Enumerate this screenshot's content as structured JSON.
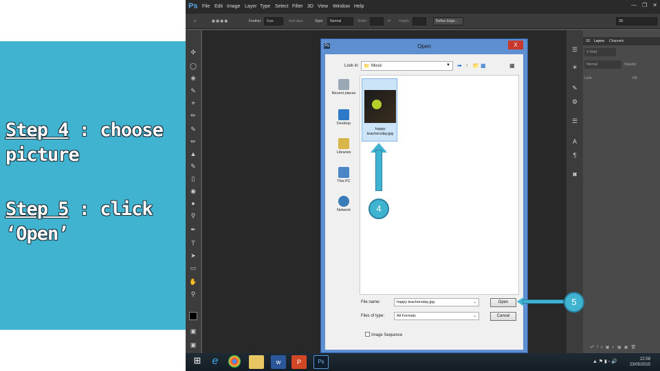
{
  "slide": {
    "step4_prefix": "Step 4",
    "step4_rest": " : choose",
    "step4_line2": "picture",
    "step5_prefix": "Step 5",
    "step5_rest": " : click",
    "step5_line2": "‘Open’"
  },
  "photoshop": {
    "logo": "Ps",
    "menu": [
      "File",
      "Edit",
      "Image",
      "Layer",
      "Type",
      "Select",
      "Filter",
      "3D",
      "View",
      "Window",
      "Help"
    ],
    "options": {
      "feather_label": "Feather:",
      "feather_value": "0 px",
      "antialias_label": "Anti-alias",
      "style_label": "Style:",
      "style_value": "Normal",
      "width_label": "Width:",
      "height_label": "Height:",
      "refine_edge": "Refine Edge...",
      "workspace": "3D"
    },
    "panels": {
      "tabs": [
        "3D",
        "Layers",
        "Channels"
      ],
      "kind_label": "Kind",
      "blend_mode": "Normal",
      "opacity_label": "Opacity:",
      "lock_label": "Lock:",
      "fill_label": "Fill:"
    }
  },
  "dialog": {
    "title": "Open",
    "close": "X",
    "look_in_label": "Look in:",
    "look_in_value": "Music",
    "places": [
      "Recent places",
      "Desktop",
      "Libraries",
      "This PC",
      "Network"
    ],
    "file": {
      "name": "happy teachersday.jpg",
      "caption_line1": "happy",
      "caption_line2": "teachersday.jpg"
    },
    "file_name_label": "File name:",
    "file_name_value": "happy teachersday.jpg",
    "files_of_type_label": "Files of type:",
    "files_of_type_value": "All Formats",
    "open_button": "Open",
    "cancel_button": "Cancel",
    "image_sequence": "Image Sequence"
  },
  "callouts": {
    "step4": "4",
    "step5": "5"
  },
  "taskbar": {
    "time": "22:58",
    "date": "23/05/2015"
  },
  "colors": {
    "accent": "#3fb3cf",
    "dialog_frame": "#5e8fd1"
  }
}
